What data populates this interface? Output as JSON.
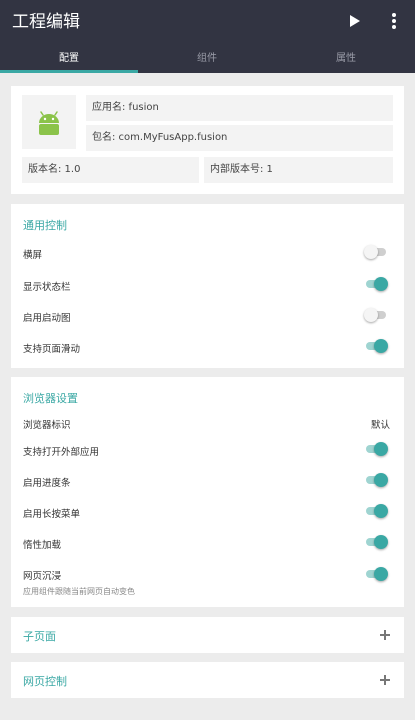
{
  "app": {
    "title": "工程编辑"
  },
  "toolbar": {
    "run_icon": "play-icon",
    "more_icon": "more-vert-icon"
  },
  "tabs": [
    "配置",
    "组件",
    "属性"
  ],
  "active_tab": 0,
  "project": {
    "app_icon": "android-icon",
    "app_name": "应用名: fusion",
    "package_name": "包名: com.MyFusApp.fusion",
    "version_name": "版本名: 1.0",
    "version_code": "内部版本号: 1"
  },
  "general": {
    "title": "通用控制",
    "items": [
      {
        "label": "横屏",
        "on": false
      },
      {
        "label": "显示状态栏",
        "on": true
      },
      {
        "label": "启用启动图",
        "on": false
      },
      {
        "label": "支持页面滑动",
        "on": true
      }
    ]
  },
  "browser": {
    "title": "浏览器设置",
    "ua_label": "浏览器标识",
    "ua_value": "默认",
    "items": [
      {
        "label": "支持打开外部应用",
        "on": true
      },
      {
        "label": "启用进度条",
        "on": true
      },
      {
        "label": "启用长按菜单",
        "on": true
      },
      {
        "label": "惰性加载",
        "on": true
      },
      {
        "label": "网页沉浸",
        "sub": "应用组件跟随当前网页自动变色",
        "on": true
      }
    ]
  },
  "collapsed": [
    {
      "title": "子页面"
    },
    {
      "title": "网页控制"
    }
  ],
  "colors": {
    "header": "#323442",
    "accent": "#3aa8a4",
    "background": "#ececec"
  }
}
